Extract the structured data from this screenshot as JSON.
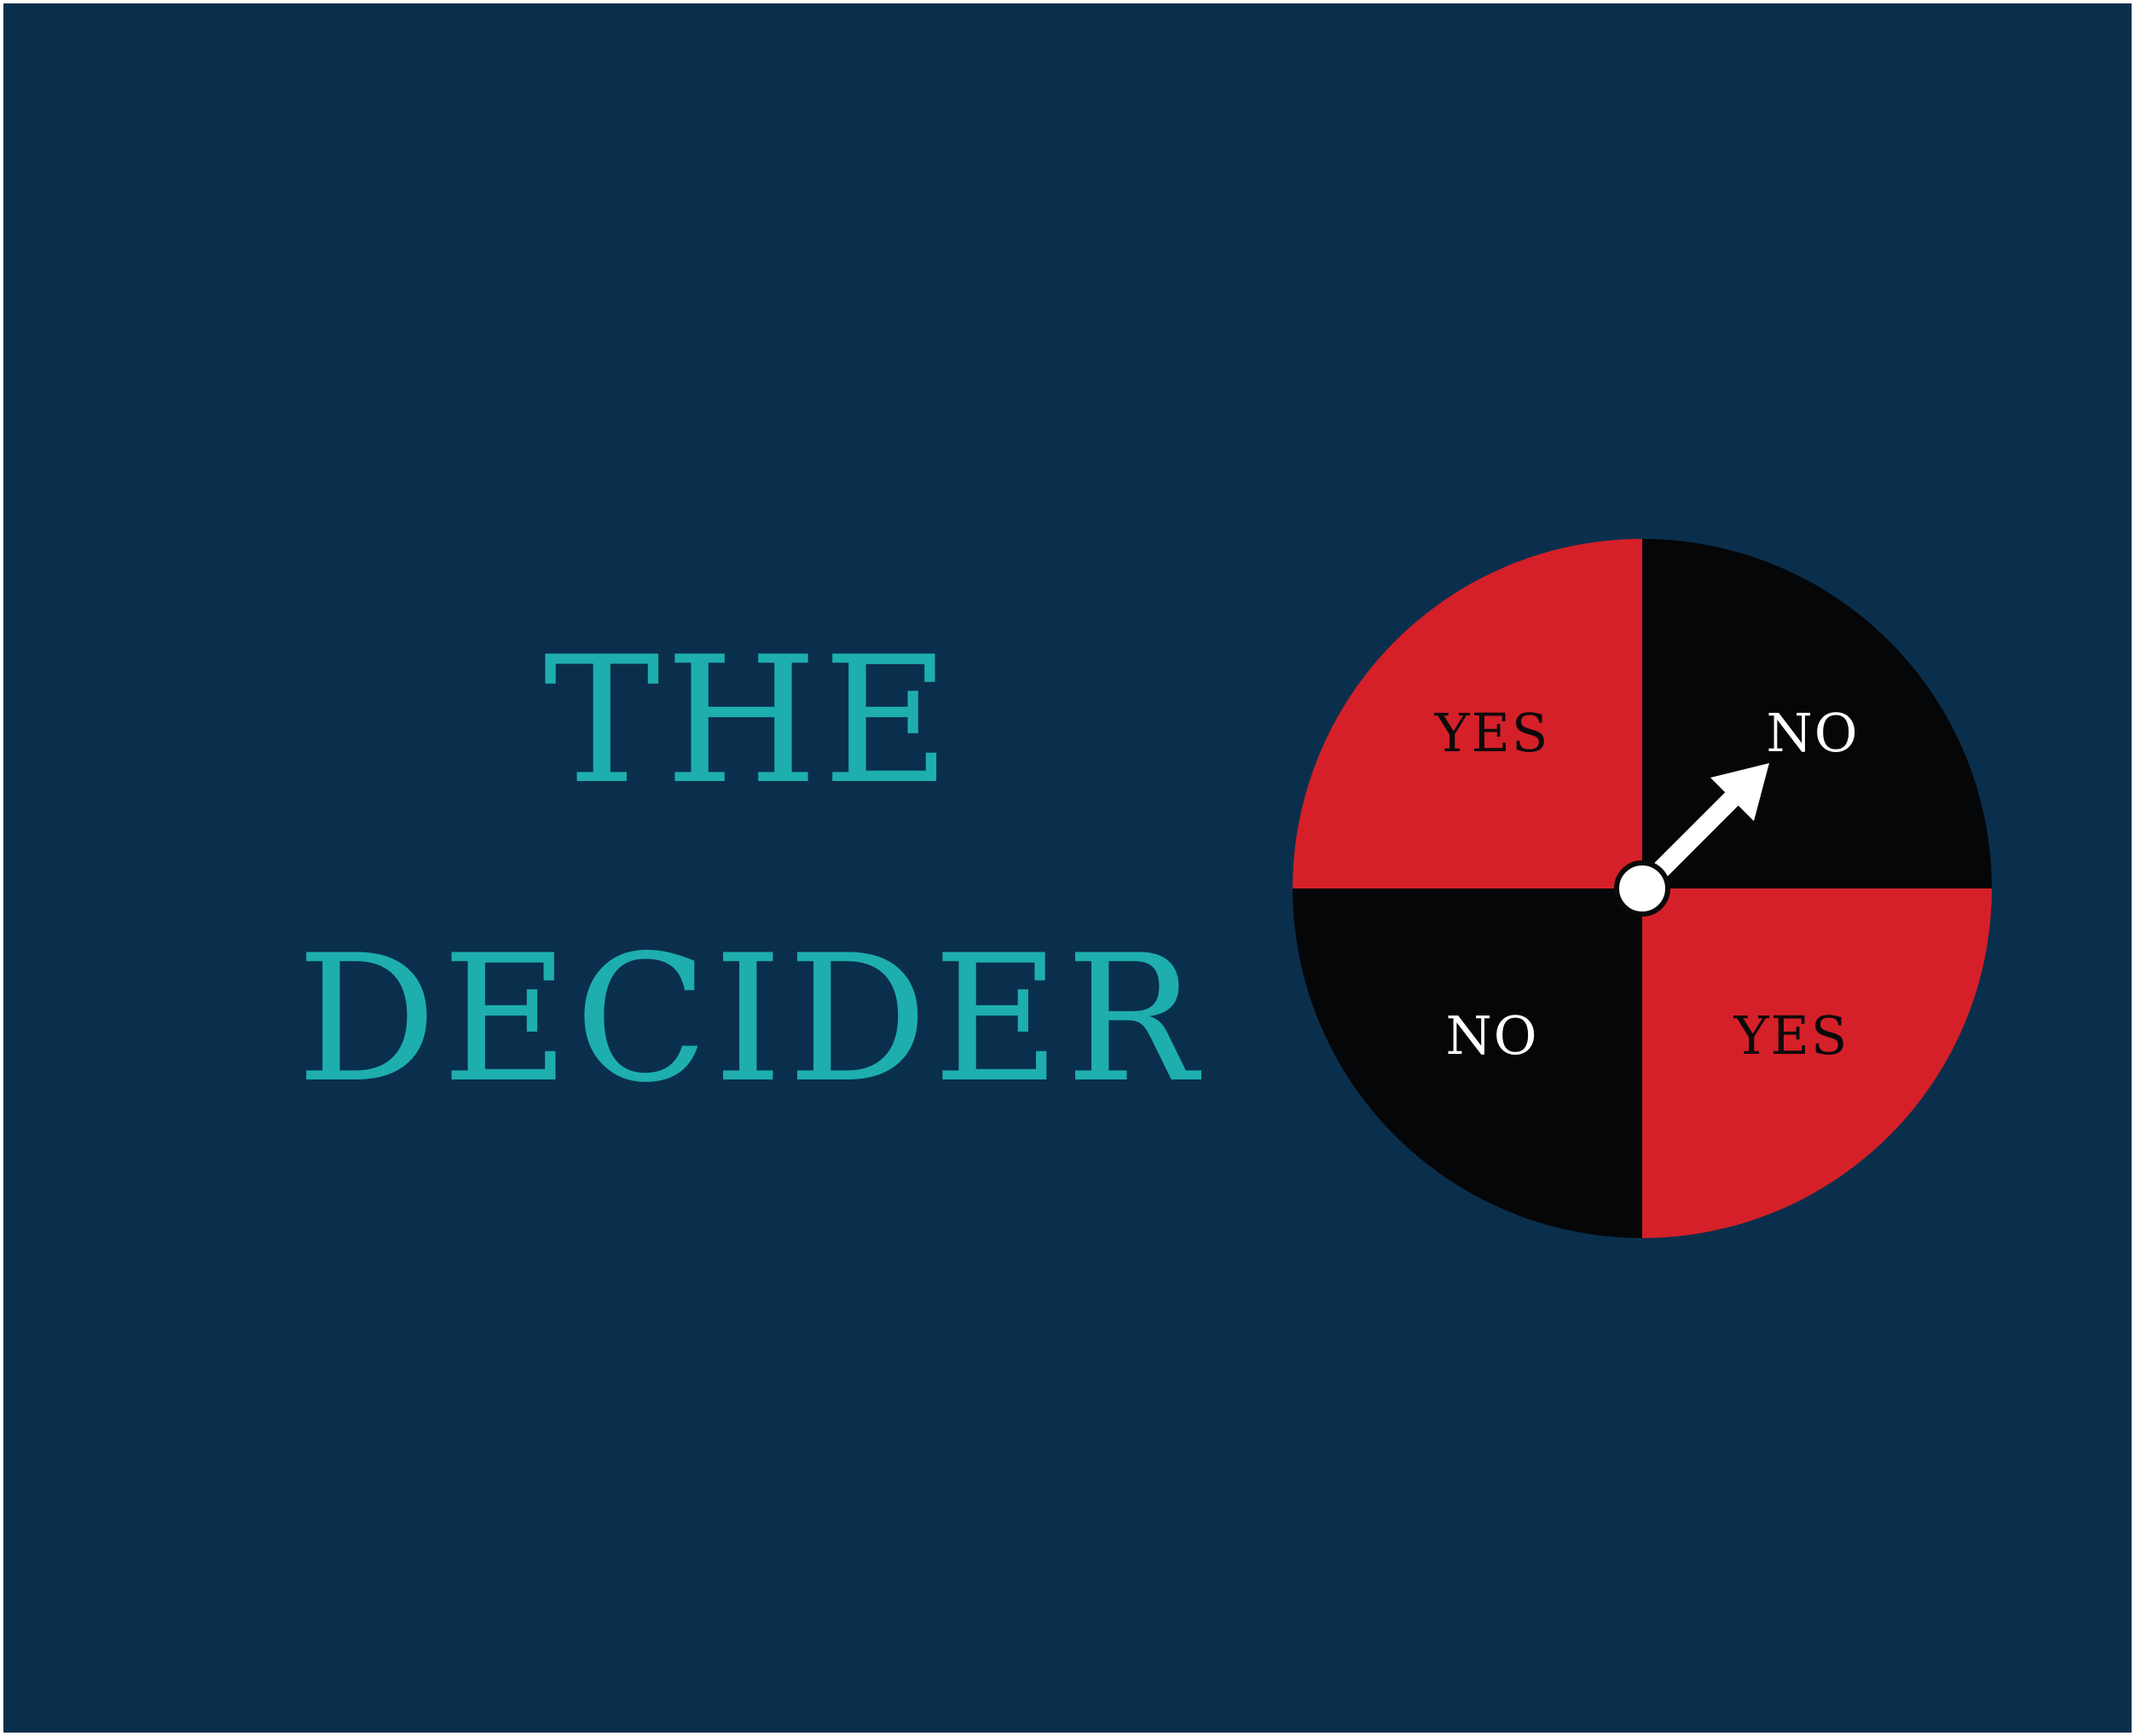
{
  "title": {
    "line1": "THE",
    "line2": "DECIDER"
  },
  "wheel": {
    "segments": [
      {
        "label": "YES",
        "position": "top-left",
        "fill": "#d52029",
        "text_color": "#0a0a0a"
      },
      {
        "label": "NO",
        "position": "top-right",
        "fill": "#050608",
        "text_color": "#ffffff"
      },
      {
        "label": "NO",
        "position": "bottom-left",
        "fill": "#050608",
        "text_color": "#ffffff"
      },
      {
        "label": "YES",
        "position": "bottom-right",
        "fill": "#d52029",
        "text_color": "#0a0a0a"
      }
    ],
    "pointer": {
      "icon": "arrow-icon",
      "points_to": "top-right",
      "color": "#ffffff"
    }
  },
  "colors": {
    "background": "#0a2f4c",
    "title": "#1eaeae",
    "yes_segment": "#d52029",
    "no_segment": "#050608"
  }
}
